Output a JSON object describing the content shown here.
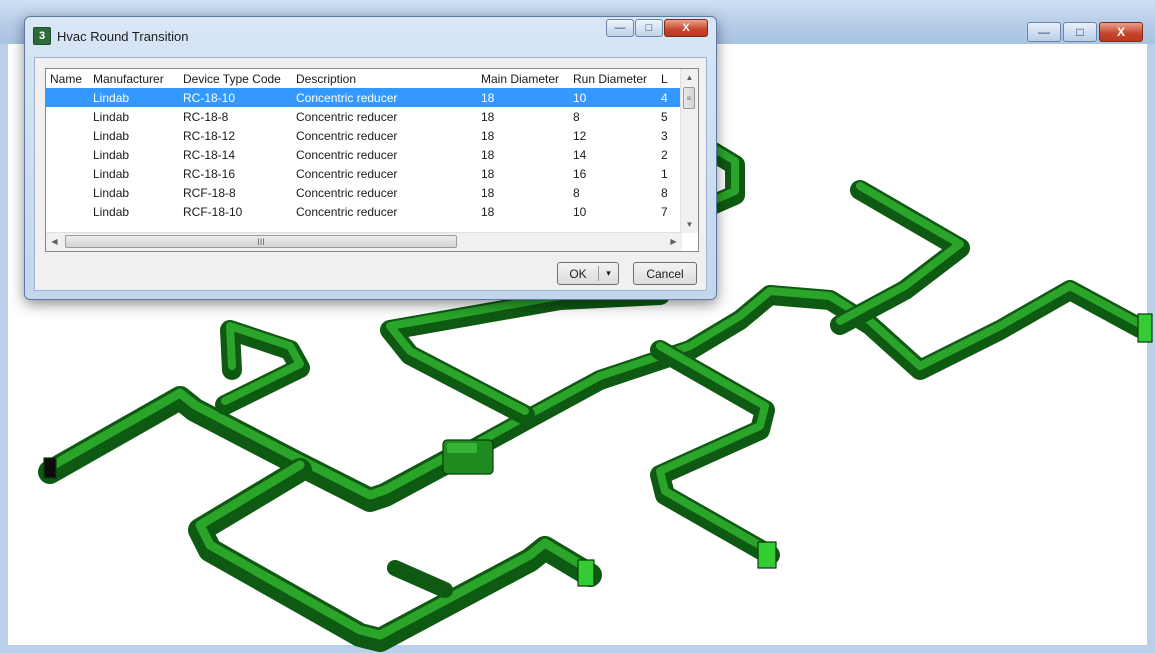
{
  "dialog": {
    "title": "Hvac Round Transition",
    "app_icon_glyph": "3",
    "minimize_glyph": "—",
    "maximize_glyph": "□",
    "close_glyph": "X",
    "columns": [
      "Name",
      "Manufacturer",
      "Device Type Code",
      "Description",
      "Main Diameter",
      "Run Diameter",
      "L"
    ],
    "rows": [
      [
        "",
        "Lindab",
        "RC-18-10",
        "Concentric reducer",
        "18",
        "10",
        "4"
      ],
      [
        "",
        "Lindab",
        "RC-18-8",
        "Concentric reducer",
        "18",
        "8",
        "5"
      ],
      [
        "",
        "Lindab",
        "RC-18-12",
        "Concentric reducer",
        "18",
        "12",
        "3"
      ],
      [
        "",
        "Lindab",
        "RC-18-14",
        "Concentric reducer",
        "18",
        "14",
        "2"
      ],
      [
        "",
        "Lindab",
        "RC-18-16",
        "Concentric reducer",
        "18",
        "16",
        "1"
      ],
      [
        "",
        "Lindab",
        "RCF-18-8",
        "Concentric reducer",
        "18",
        "8",
        "8"
      ],
      [
        "",
        "Lindab",
        "RCF-18-10",
        "Concentric reducer",
        "18",
        "10",
        "7"
      ]
    ],
    "selected_row": 0,
    "hscroll_thumb_glyph": "III",
    "ok_label": "OK",
    "ok_dropdown_glyph": "▾",
    "cancel_label": "Cancel"
  },
  "background_window": {
    "minimize_glyph": "—",
    "maximize_glyph": "□",
    "close_glyph": "X"
  },
  "colors": {
    "duct_fill": "#1f8a1f",
    "duct_dark": "#0f5a12",
    "selection": "#3399ff"
  }
}
